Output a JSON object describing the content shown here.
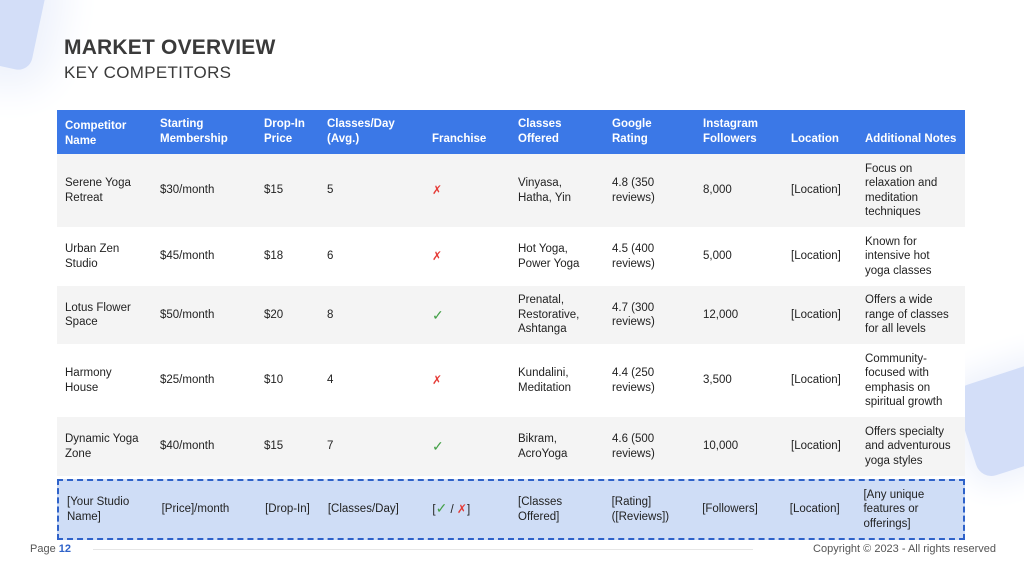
{
  "header": {
    "title": "MARKET OVERVIEW",
    "subtitle": "KEY COMPETITORS"
  },
  "table": {
    "columns": [
      "Competitor Name",
      "Starting Membership",
      "Drop-In Price",
      "Classes/Day (Avg.)",
      "Franchise",
      "Classes Offered",
      "Google Rating",
      "Instagram Followers",
      "Location",
      "Additional Notes"
    ],
    "rows": [
      {
        "name": "Serene Yoga Retreat",
        "membership": "$30/month",
        "dropin": "$15",
        "classes_day": "5",
        "franchise": "✗",
        "classes": "Vinyasa, Hatha, Yin",
        "rating": "4.8 (350 reviews)",
        "followers": "8,000",
        "location": "[Location]",
        "notes": "Focus on relaxation and meditation techniques"
      },
      {
        "name": "Urban Zen Studio",
        "membership": "$45/month",
        "dropin": "$18",
        "classes_day": "6",
        "franchise": "✗",
        "classes": "Hot Yoga, Power Yoga",
        "rating": "4.5 (400 reviews)",
        "followers": "5,000",
        "location": "[Location]",
        "notes": "Known for intensive hot yoga classes"
      },
      {
        "name": "Lotus Flower Space",
        "membership": "$50/month",
        "dropin": "$20",
        "classes_day": "8",
        "franchise": "✓",
        "classes": "Prenatal, Restorative, Ashtanga",
        "rating": "4.7 (300 reviews)",
        "followers": "12,000",
        "location": "[Location]",
        "notes": "Offers a wide range of classes for all levels"
      },
      {
        "name": "Harmony House",
        "membership": "$25/month",
        "dropin": "$10",
        "classes_day": "4",
        "franchise": "✗",
        "classes": "Kundalini, Meditation",
        "rating": "4.4 (250 reviews)",
        "followers": "3,500",
        "location": "[Location]",
        "notes": "Community-focused with emphasis on spiritual growth"
      },
      {
        "name": "Dynamic Yoga Zone",
        "membership": "$40/month",
        "dropin": "$15",
        "classes_day": "7",
        "franchise": "✓",
        "classes": "Bikram, AcroYoga",
        "rating": "4.6 (500 reviews)",
        "followers": "10,000",
        "location": "[Location]",
        "notes": "Offers specialty and adventurous yoga styles"
      }
    ],
    "your_row": {
      "name": "[Your Studio Name]",
      "membership": "[Price]/month",
      "dropin": "[Drop-In]",
      "classes_day": "[Classes/Day]",
      "franchise_open": "[",
      "franchise_check": "✓",
      "franchise_sep": " / ",
      "franchise_x": "✗",
      "franchise_close": "]",
      "classes": "[Classes Offered]",
      "rating": "[Rating] ([Reviews])",
      "followers": "[Followers]",
      "location": "[Location]",
      "notes": "[Any unique features or offerings]"
    }
  },
  "footer": {
    "page_label": "Page",
    "page_number": "12",
    "copyright": "Copyright © 2023 - All rights reserved"
  },
  "colors": {
    "header_bg": "#3b78e7",
    "highlight_row": "#cfddf6",
    "check": "#43a047",
    "cross": "#e53935"
  }
}
